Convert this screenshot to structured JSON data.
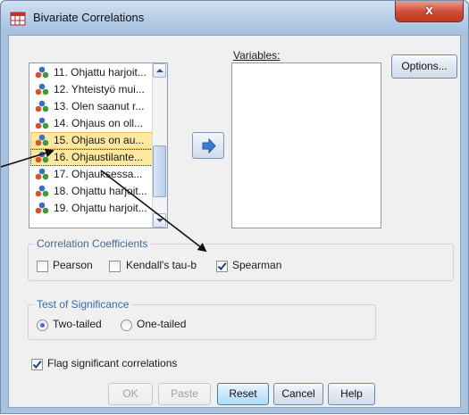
{
  "window": {
    "title": "Bivariate Correlations",
    "close_glyph": "x"
  },
  "variables_list": {
    "items": [
      {
        "label": "11. Ohjattu harjoit...",
        "selected": false
      },
      {
        "label": "12. Yhteistyö mui...",
        "selected": false
      },
      {
        "label": "13. Olen saanut r...",
        "selected": false
      },
      {
        "label": "14. Ohjaus on oll...",
        "selected": false
      },
      {
        "label": "15. Ohjaus on au...",
        "selected": true
      },
      {
        "label": "16. Ohjaustilante...",
        "selected": true
      },
      {
        "label": "17. Ohjauksessa...",
        "selected": false
      },
      {
        "label": "18. Ohjattu harjoit...",
        "selected": false
      },
      {
        "label": "19. Ohjattu harjoit...",
        "selected": false
      }
    ]
  },
  "target": {
    "label": "Variables:"
  },
  "options_button": {
    "label": "Options..."
  },
  "correlation_coefficients": {
    "legend": "Correlation Coefficients",
    "pearson": {
      "label": "Pearson",
      "checked": false
    },
    "kendall": {
      "label": "Kendall's tau-b",
      "checked": false
    },
    "spearman": {
      "label": "Spearman",
      "checked": true
    }
  },
  "test_of_significance": {
    "legend": "Test of Significance",
    "two_tailed": {
      "label": "Two-tailed",
      "selected": true
    },
    "one_tailed": {
      "label": "One-tailed",
      "selected": false
    }
  },
  "flag_significant": {
    "label": "Flag significant correlations",
    "checked": true
  },
  "buttons": {
    "ok": "OK",
    "paste": "Paste",
    "reset": "Reset",
    "cancel": "Cancel",
    "help": "Help"
  },
  "colors": {
    "accent": "#3b6aa0",
    "selection": "#fde8a0",
    "titlebar": "#b3cbe5",
    "close": "#cc4b36"
  },
  "icons": {
    "app": "spss-table-icon",
    "variable": "ordinal-variable-icon",
    "move": "right-arrow-icon",
    "check": "checkmark-icon"
  }
}
